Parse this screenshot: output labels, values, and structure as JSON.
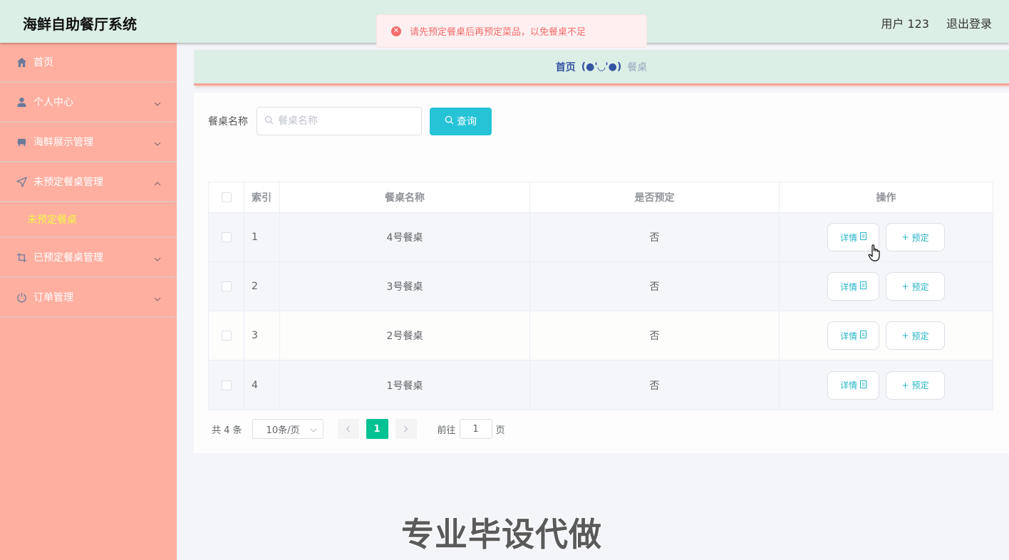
{
  "header": {
    "title": "海鲜自助餐厅系统",
    "user_label": "用户 123",
    "logout_label": "退出登录"
  },
  "toast": {
    "message": "请先预定餐桌后再预定菜品，以免餐桌不足",
    "icon": "error-circle-icon",
    "color": "#f56c6c"
  },
  "sidebar": {
    "items": [
      {
        "label": "首页",
        "icon": "home-icon"
      },
      {
        "label": "个人中心",
        "icon": "user-icon"
      },
      {
        "label": "海鲜展示管理",
        "icon": "tray-icon"
      },
      {
        "label": "未预定餐桌管理",
        "icon": "send-icon",
        "expanded": true
      },
      {
        "label": "已预定餐桌管理",
        "icon": "crop-icon"
      },
      {
        "label": "订单管理",
        "icon": "power-icon"
      }
    ],
    "submenu": {
      "label": "未预定餐桌"
    }
  },
  "breadcrumb": {
    "home": "首页",
    "separator": "(●'◡'●)",
    "current": "餐桌"
  },
  "search": {
    "label": "餐桌名称",
    "placeholder": "餐桌名称",
    "button_label": "查询"
  },
  "table": {
    "headers": {
      "index": "索引",
      "name": "餐桌名称",
      "reserved": "是否预定",
      "actions": "操作"
    },
    "rows": [
      {
        "index": "1",
        "name": "4号餐桌",
        "reserved": "否"
      },
      {
        "index": "2",
        "name": "3号餐桌",
        "reserved": "否"
      },
      {
        "index": "3",
        "name": "2号餐桌",
        "reserved": "否"
      },
      {
        "index": "4",
        "name": "1号餐桌",
        "reserved": "否"
      }
    ],
    "detail_label": "详情",
    "book_label": "预定"
  },
  "pagination": {
    "total_label": "共 4 条",
    "page_size": "10条/页",
    "current_page": "1",
    "goto_prefix": "前往",
    "goto_value": "1",
    "goto_suffix": "页"
  },
  "watermark": "专业毕设代做",
  "colors": {
    "header_bg": "#dcefe6",
    "sidebar_bg": "#ffafa0",
    "accent": "#26c3d6",
    "page_active": "#00c292"
  }
}
